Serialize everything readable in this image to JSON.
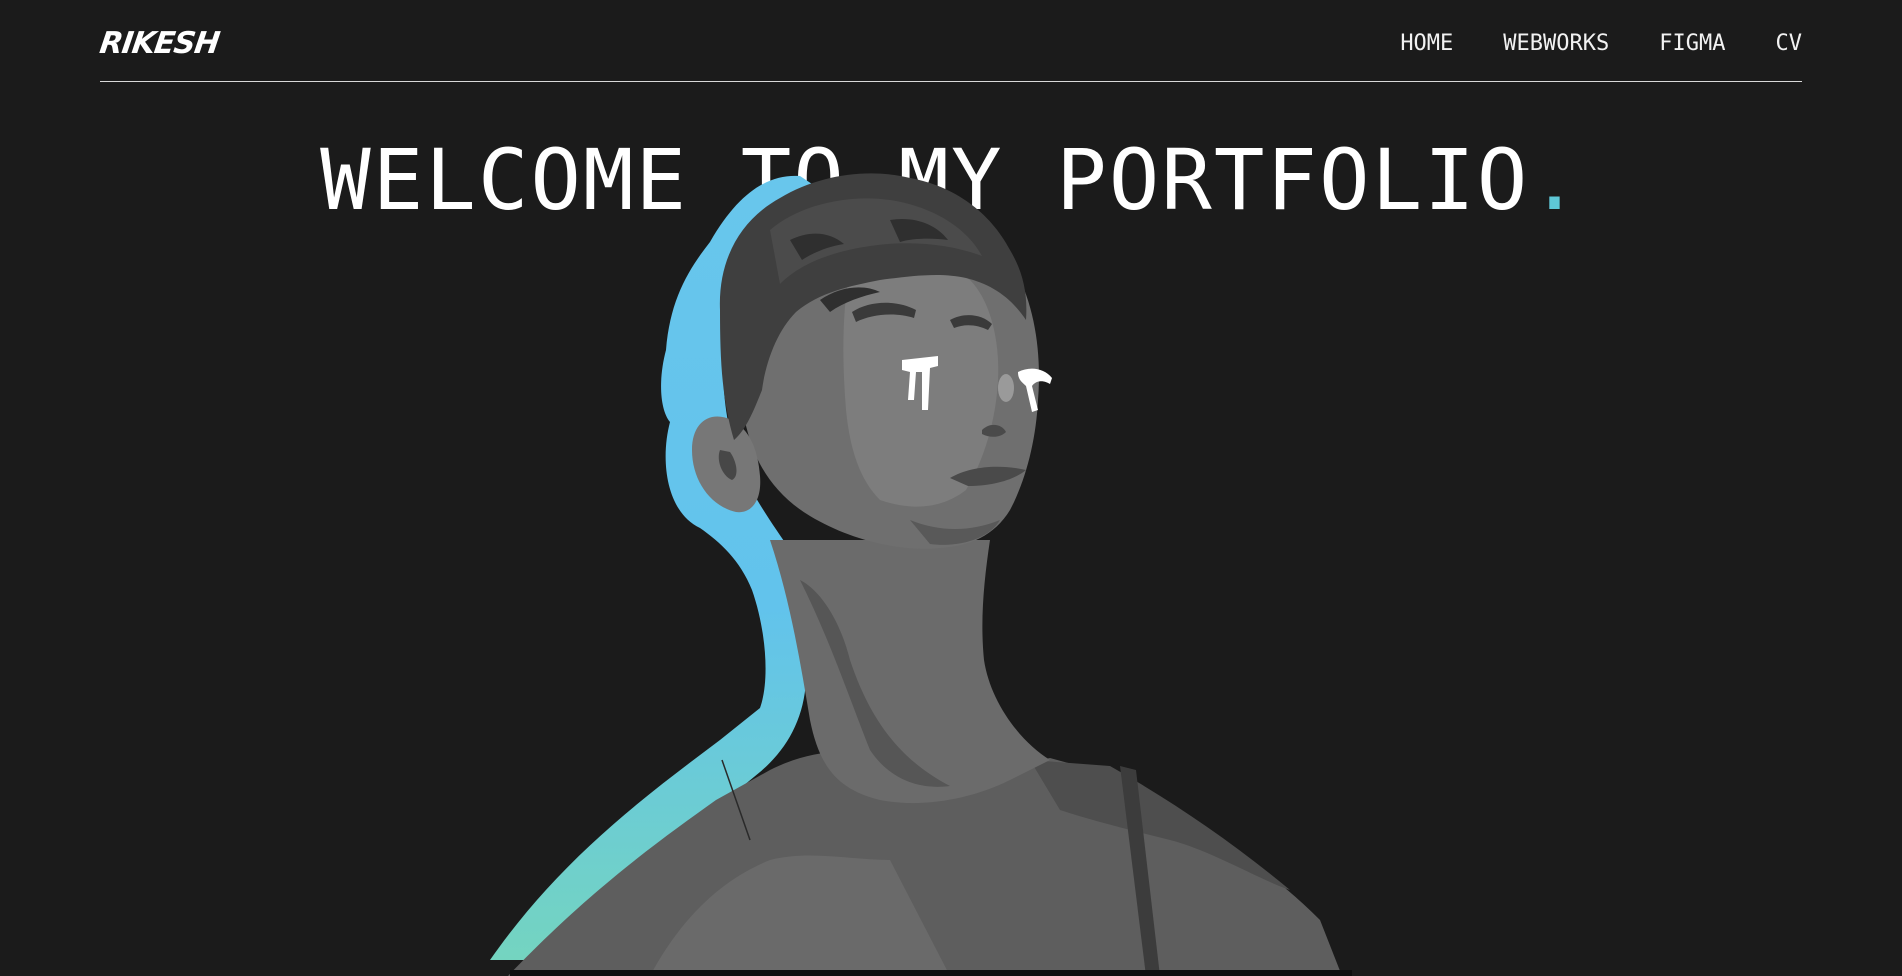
{
  "header": {
    "logo": "RIKESH",
    "nav": [
      {
        "label": "HOME"
      },
      {
        "label": "WEBWORKS"
      },
      {
        "label": "FIGMA"
      },
      {
        "label": "CV"
      }
    ]
  },
  "hero": {
    "title": "WELCOME TO MY PORTFOLIO",
    "dot": "."
  },
  "colors": {
    "background": "#1b1b1b",
    "accent": "#5ec7d6",
    "accent_gradient_start": "#6ac8f0",
    "accent_gradient_end": "#72d3c0",
    "text": "#ffffff"
  },
  "portrait": {
    "icon": "portrait-illustration"
  }
}
